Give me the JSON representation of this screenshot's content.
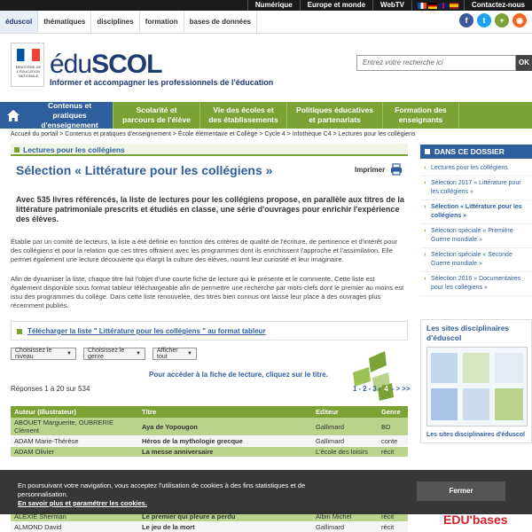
{
  "topbar": {
    "links": [
      "Numérique",
      "Europe et monde",
      "WebTV",
      "Contactez-nous"
    ]
  },
  "navbar": {
    "items": [
      "éduscol",
      "thématiques",
      "disciplines",
      "formation",
      "bases de données"
    ]
  },
  "social": [
    {
      "name": "facebook-icon",
      "glyph": "f",
      "color": "#3b5998"
    },
    {
      "name": "twitter-icon",
      "glyph": "t",
      "color": "#1da1f2"
    },
    {
      "name": "netvibes-icon",
      "glyph": "+",
      "color": "#7aa234"
    },
    {
      "name": "rss-icon",
      "glyph": "◉",
      "color": "#f26522"
    }
  ],
  "header": {
    "ministry": "MINISTÈRE DE L'ÉDUCATION NATIONALE",
    "logo_edu": "édu",
    "logo_scol": "SCOL",
    "tagline": "Informer et accompagner les professionnels de l'éducation",
    "search_placeholder": "Entrez votre recherche ici",
    "search_button": "OK"
  },
  "mainnav": {
    "tabs": [
      {
        "label": "Contenus et pratiques d'enseignement",
        "active": true
      },
      {
        "label": "Scolarité et parcours de l'élève",
        "active": false
      },
      {
        "label": "Vie des écoles et des établissements",
        "active": false
      },
      {
        "label": "Politiques éducatives et partenariats",
        "active": false
      },
      {
        "label": "Formation des enseignants",
        "active": false
      }
    ]
  },
  "breadcrumb": "Accueil du portail > Contenus et pratiques d'enseignement > École élémentaire et Collège > Cycle 4 > Infothèque C4 > Lectures pour les collégiens",
  "section": "Lectures pour les collégiens",
  "title": "Sélection « Littérature pour les collégiens »",
  "print_label": "Imprimer",
  "lead": "Avec 535 livres référencés, la liste de lectures pour les collégiens propose, en parallèle aux titres de la littérature patrimoniale prescrits et étudiés en classe, une série d'ouvrages pour enrichir l'expérience des élèves.",
  "para1": "Établie par un comité de lecteurs, la liste a été définie en fonction des critères de qualité de l'écriture, de pertinence et d'intérêt pour des collégiens et pour la relation que ces titres offraient avec les programmes dont ils enrichissent l'approche et l'assimilation. Elle permet également une lecture découverte qui élargit la culture des élèves, nourrit leur curiosité et leur imaginaire.",
  "para2": "Afin de dynamiser la liste, chaque titre fait l'objet d'une courte fiche de lecture qui le présente et le commente. Cette liste est également disponible sous format tableur téléchargeable afin de permettre une recherche par mots-clefs dont le premier au moins est issu des programmes du collège. Dans cette liste renouvelée, des titres bien connus ont laissé leur place à des ouvrages plus récemment publiés.",
  "download_link": "Télécharger la liste \" Littérature pour les collégiens \" au format tableur",
  "filters": [
    "Choisissez le niveau",
    "Choisissez le genre",
    "Afficher tout"
  ],
  "hint": "Pour accéder à la fiche de lecture, cliquez sur le titre.",
  "count": "Réponses 1 à 20 sur 534",
  "pagination": {
    "pages": [
      "1",
      "2",
      "3",
      "4"
    ],
    "current": "4",
    "next": ">",
    "last": ">>"
  },
  "table": {
    "headers": [
      "Auteur (Illustrateur)",
      "Titre",
      "Editeur",
      "Genre"
    ],
    "rows": [
      [
        "ABOUET Marguerite, OUBRERIE Clément",
        "Aya de Yopougon",
        "Gallimard",
        "BD"
      ],
      [
        "ADAM Marie-Thérèse",
        "Héros de la mythologie grecque",
        "Gallimard",
        "conte"
      ],
      [
        "ADAM Olivier",
        "La messe anniversaire",
        "L'école des loisirs",
        "récit"
      ],
      [
        "ALEXIE Sherman",
        "Le premier qui pleure a perdu",
        "Albin Michel",
        "récit"
      ],
      [
        "ALMOND David",
        "Le jeu de la mort",
        "Gallimard",
        "récit"
      ]
    ]
  },
  "sidebar": {
    "heading": "DANS CE DOSSIER",
    "items": [
      {
        "label": "Lectures pour les collégiens",
        "active": false
      },
      {
        "label": "Sélection 2017 « Littérature pour les collégiens »",
        "active": false
      },
      {
        "label": "Sélection « Littérature pour les collégiens »",
        "active": true
      },
      {
        "label": "Sélection spéciale « Première Guerre mondiale »",
        "active": false
      },
      {
        "label": "Sélection spéciale « Seconde Guerre mondiale »",
        "active": false
      },
      {
        "label": "Sélection 2016 « Documentaires pour les collégiens »",
        "active": false
      }
    ],
    "sites_heading": "Les sites disciplinaires d'éduscol",
    "sites_link": "Les sites disciplinaires d'éduscol"
  },
  "edubases": "EDU'bases",
  "cookie": {
    "text": "En poursuivant votre navigation, vous acceptez l'utilisation de cookies à des fins statistiques et de personnalisation.",
    "link": "En savoir plus et paramétrer les cookies.",
    "button": "Fermer"
  }
}
